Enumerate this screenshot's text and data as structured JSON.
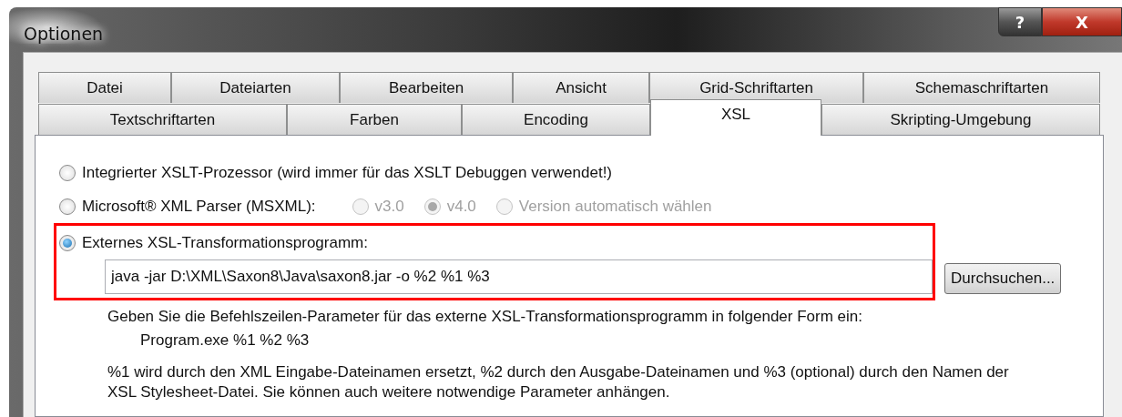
{
  "window": {
    "title": "Optionen",
    "buttons": [
      {
        "kind": "help",
        "label": "?"
      },
      {
        "kind": "close",
        "label": "X"
      }
    ]
  },
  "tab_rows": [
    [
      {
        "label": "Datei",
        "selected": false
      },
      {
        "label": "Dateiarten",
        "selected": false
      },
      {
        "label": "Bearbeiten",
        "selected": false
      },
      {
        "label": "Ansicht",
        "selected": false
      },
      {
        "label": "Grid-Schriftarten",
        "selected": false
      },
      {
        "label": "Schemaschriftarten",
        "selected": false
      }
    ],
    [
      {
        "label": "Textschriftarten",
        "selected": false
      },
      {
        "label": "Farben",
        "selected": false
      },
      {
        "label": "Encoding",
        "selected": false
      },
      {
        "label": "XSL",
        "selected": true
      },
      {
        "label": "Skripting-Umgebung",
        "selected": false
      }
    ]
  ],
  "options": [
    {
      "label": "Integrierter XSLT-Prozessor (wird immer für das XSLT Debuggen verwendet!)",
      "selected": false,
      "highlighted": false
    },
    {
      "label": "Microsoft® XML Parser (MSXML):",
      "selected": false,
      "highlighted": false,
      "sub_options": [
        {
          "label": "v3.0",
          "selected": false,
          "disabled": true
        },
        {
          "label": "v4.0",
          "selected": true,
          "disabled": true
        },
        {
          "label": "Version automatisch wählen",
          "selected": false,
          "disabled": true
        }
      ]
    },
    {
      "label": "Externes XSL-Transformationsprogramm:",
      "selected": true,
      "highlighted": true,
      "field": {
        "value": "java -jar D:\\XML\\Saxon8\\Java\\saxon8.jar -o %2 %1 %3"
      },
      "button": "Durchsuchen..."
    }
  ],
  "hint": "Geben Sie die Befehlszeilen-Parameter für das externe XSL-Transformationsprogramm in folgender Form ein:",
  "example": "Program.exe %1 %2 %3",
  "note": "%1 wird durch den XML Eingabe-Dateinamen ersetzt, %2 durch den Ausgabe-Dateinamen und %3 (optional) durch den Namen der XSL Stylesheet-Datei. Sie können auch weitere notwendige Parameter anhängen."
}
